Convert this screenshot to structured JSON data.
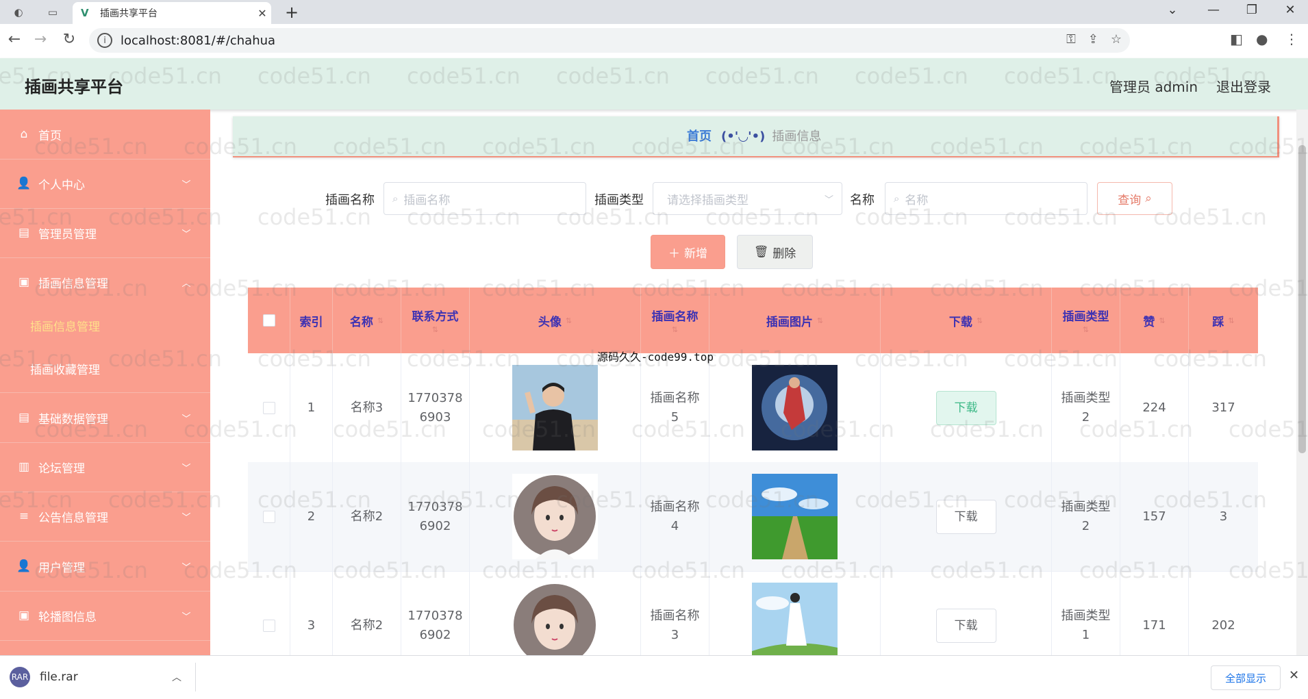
{
  "browser": {
    "tab_title": "插画共享平台",
    "url": "localhost:8081/#/chahua",
    "download_file": "file.rar",
    "show_all": "全部显示"
  },
  "header": {
    "app_title": "插画共享平台",
    "admin_label": "管理员 admin",
    "logout": "退出登录"
  },
  "sidebar": {
    "items": [
      {
        "label": "首页",
        "icon": "home-icon"
      },
      {
        "label": "个人中心",
        "icon": "user-icon"
      },
      {
        "label": "管理员管理",
        "icon": "tray-icon"
      },
      {
        "label": "插画信息管理",
        "icon": "doc-icon"
      },
      {
        "label": "基础数据管理",
        "icon": "tray-icon"
      },
      {
        "label": "论坛管理",
        "icon": "chart-icon"
      },
      {
        "label": "公告信息管理",
        "icon": "list-icon"
      },
      {
        "label": "用户管理",
        "icon": "user-icon"
      },
      {
        "label": "轮播图信息",
        "icon": "doc-icon"
      }
    ],
    "submenu": [
      {
        "label": "插画信息管理",
        "active": true
      },
      {
        "label": "插画收藏管理",
        "active": false
      }
    ]
  },
  "breadcrumb": {
    "home": "首页",
    "face": "(•'◡'•)",
    "current": "插画信息"
  },
  "search": {
    "name_label": "插画名称",
    "name_placeholder": "插画名称",
    "type_label": "插画类型",
    "type_placeholder": "请选择插画类型",
    "title_label": "名称",
    "title_placeholder": "名称",
    "query_button": "查询"
  },
  "actions": {
    "add": "新增",
    "delete": "删除"
  },
  "table": {
    "headers": {
      "index": "索引",
      "name": "名称",
      "contact": "联系方式",
      "avatar": "头像",
      "illustration_name": "插画名称",
      "illustration_image": "插画图片",
      "download": "下载",
      "illustration_type": "插画类型",
      "likes": "赞",
      "dislikes": "踩"
    },
    "rows": [
      {
        "index": "1",
        "name": "名称3",
        "contact": "17703786903",
        "illustration_name": "插画名称5",
        "download": "下载",
        "illustration_type": "插画类型2",
        "likes": "224",
        "dislikes": "317"
      },
      {
        "index": "2",
        "name": "名称2",
        "contact": "17703786902",
        "illustration_name": "插画名称4",
        "download": "下载",
        "illustration_type": "插画类型2",
        "likes": "157",
        "dislikes": "3"
      },
      {
        "index": "3",
        "name": "名称2",
        "contact": "17703786902",
        "illustration_name": "插画名称3",
        "download": "下载",
        "illustration_type": "插画类型1",
        "likes": "171",
        "dislikes": "202"
      }
    ]
  },
  "overlay_text": "源码久久-code99.top",
  "watermark": "code51.cn",
  "colors": {
    "sidebar_bg": "#fa9e8e",
    "header_bg": "#dff0e8",
    "table_header_text": "#3d32b3",
    "active_submenu": "#ffe08a"
  }
}
